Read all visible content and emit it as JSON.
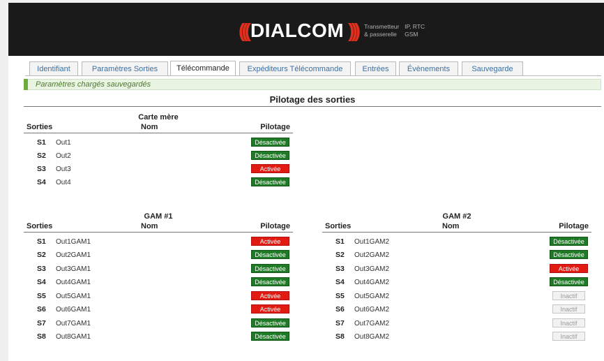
{
  "header": {
    "brand": "DIALCOM",
    "tag_line1_a": "Transmetteur",
    "tag_line1_b": "IP, RTC",
    "tag_line2_a": "& passerelle",
    "tag_line2_b": "GSM"
  },
  "tabs": [
    {
      "label": "Identifiant",
      "active": false
    },
    {
      "label": "Paramètres Sorties",
      "active": false
    },
    {
      "label": "Télécommande",
      "active": true
    },
    {
      "label": "Expéditeurs Télécommande",
      "active": false
    },
    {
      "label": "Entrées",
      "active": false
    },
    {
      "label": "Évènements",
      "active": false
    },
    {
      "label": "Sauvegarde",
      "active": false
    }
  ],
  "notice": "Paramètres chargés sauvegardés",
  "section_title": "Pilotage des sorties",
  "columns": {
    "sorties": "Sorties",
    "nom": "Nom",
    "pilotage": "Pilotage"
  },
  "tables": {
    "carte_mere": {
      "title": "Carte mère",
      "rows": [
        {
          "id": "S1",
          "name": "Out1",
          "state": "Désactivée"
        },
        {
          "id": "S2",
          "name": "Out2",
          "state": "Désactivée"
        },
        {
          "id": "S3",
          "name": "Out3",
          "state": "Activée"
        },
        {
          "id": "S4",
          "name": "Out4",
          "state": "Désactivée"
        }
      ]
    },
    "gam1": {
      "title": "GAM #1",
      "rows": [
        {
          "id": "S1",
          "name": "Out1GAM1",
          "state": "Activée"
        },
        {
          "id": "S2",
          "name": "Out2GAM1",
          "state": "Désactivée"
        },
        {
          "id": "S3",
          "name": "Out3GAM1",
          "state": "Désactivée"
        },
        {
          "id": "S4",
          "name": "Out4GAM1",
          "state": "Désactivée"
        },
        {
          "id": "S5",
          "name": "Out5GAM1",
          "state": "Activée"
        },
        {
          "id": "S6",
          "name": "Out6GAM1",
          "state": "Activée"
        },
        {
          "id": "S7",
          "name": "Out7GAM1",
          "state": "Désactivée"
        },
        {
          "id": "S8",
          "name": "Out8GAM1",
          "state": "Désactivée"
        }
      ]
    },
    "gam2": {
      "title": "GAM #2",
      "rows": [
        {
          "id": "S1",
          "name": "Out1GAM2",
          "state": "Désactivée"
        },
        {
          "id": "S2",
          "name": "Out2GAM2",
          "state": "Désactivée"
        },
        {
          "id": "S3",
          "name": "Out3GAM2",
          "state": "Activée"
        },
        {
          "id": "S4",
          "name": "Out4GAM2",
          "state": "Désactivée"
        },
        {
          "id": "S5",
          "name": "Out5GAM2",
          "state": "Inactif"
        },
        {
          "id": "S6",
          "name": "Out6GAM2",
          "state": "Inactif"
        },
        {
          "id": "S7",
          "name": "Out7GAM2",
          "state": "Inactif"
        },
        {
          "id": "S8",
          "name": "Out8GAM2",
          "state": "Inactif"
        }
      ]
    }
  },
  "colors": {
    "activee": "#e11b12",
    "desactivee": "#1f7a25",
    "inactif": "#f2f2f2",
    "notice_bar": "#6cab3c",
    "accent": "#e0301e"
  }
}
